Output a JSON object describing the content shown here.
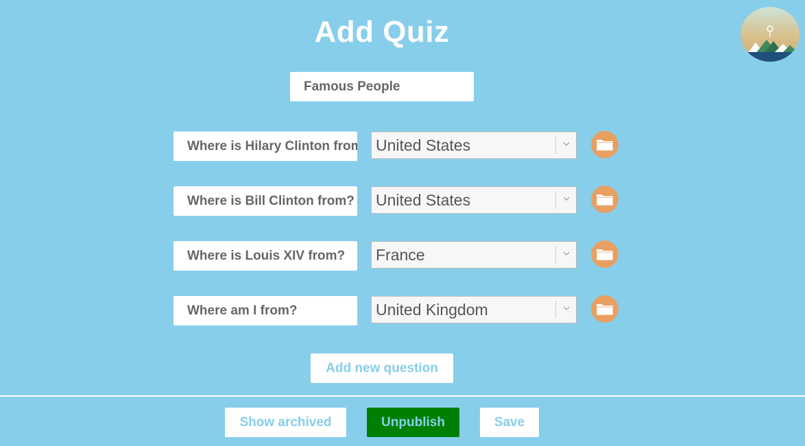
{
  "page": {
    "title": "Add Quiz"
  },
  "quiz": {
    "name": "Famous People"
  },
  "questions": [
    {
      "question": "Where is Hilary Clinton from?",
      "answer": "United States"
    },
    {
      "question": "Where is Bill Clinton from?",
      "answer": "United States"
    },
    {
      "question": "Where is Louis XIV from?",
      "answer": "France"
    },
    {
      "question": "Where am I from?",
      "answer": "United Kingdom"
    }
  ],
  "actions": {
    "add_question": "Add new question",
    "show_archived": "Show archived",
    "unpublish": "Unpublish",
    "save": "Save"
  },
  "icons": {
    "folder": "folder-icon",
    "dropdown": "chevron-down-icon",
    "avatar": "avatar"
  },
  "colors": {
    "background": "#87ceeb",
    "folder_button": "#e8a062",
    "unpublish": "#008000"
  }
}
